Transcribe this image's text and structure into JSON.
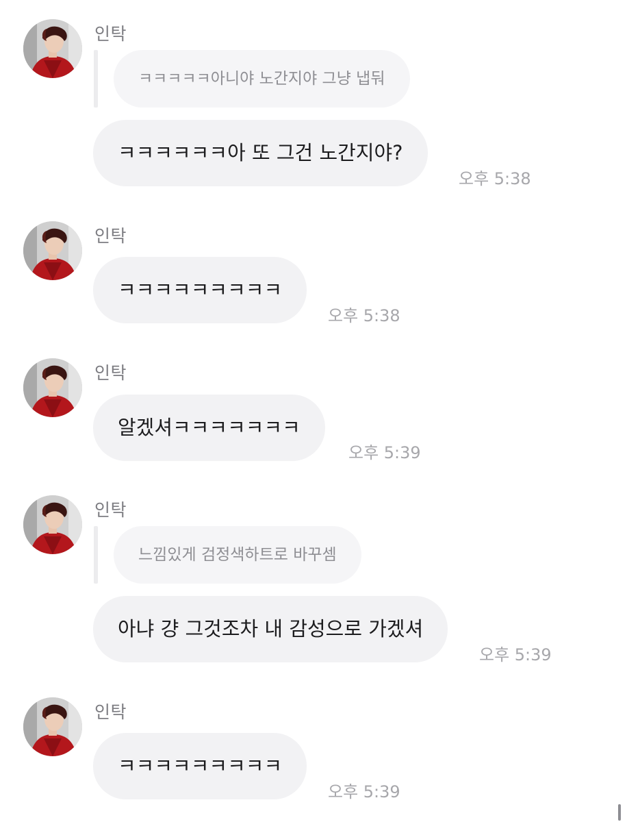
{
  "colors": {
    "bubble_bg": "#f2f2f4",
    "quote_bg": "#f5f5f7",
    "sender_text": "#7d7d82",
    "time_text": "#a7a7ab",
    "avatar_jacket": "#b3171c"
  },
  "messages": [
    {
      "sender": "인탁",
      "avatar_icon": "profile-photo",
      "quote": "ㅋㅋㅋㅋㅋ아니야 노간지야 그냥 냅둬",
      "text": "ㅋㅋㅋㅋㅋㅋ아 또 그건 노간지야?",
      "time": "오후 5:38"
    },
    {
      "sender": "인탁",
      "avatar_icon": "profile-photo",
      "text": "ㅋㅋㅋㅋㅋㅋㅋㅋㅋ",
      "time": "오후 5:38"
    },
    {
      "sender": "인탁",
      "avatar_icon": "profile-photo",
      "text": "알겠셔ㅋㅋㅋㅋㅋㅋㅋ",
      "time": "오후 5:39"
    },
    {
      "sender": "인탁",
      "avatar_icon": "profile-photo",
      "quote": "느낌있게 검정색하트로 바꾸셈",
      "text": "아냐 걍 그것조차 내 감성으로 가겠셔",
      "time": "오후 5:39"
    },
    {
      "sender": "인탁",
      "avatar_icon": "profile-photo",
      "text": "ㅋㅋㅋㅋㅋㅋㅋㅋㅋ",
      "time": "오후 5:39"
    }
  ]
}
